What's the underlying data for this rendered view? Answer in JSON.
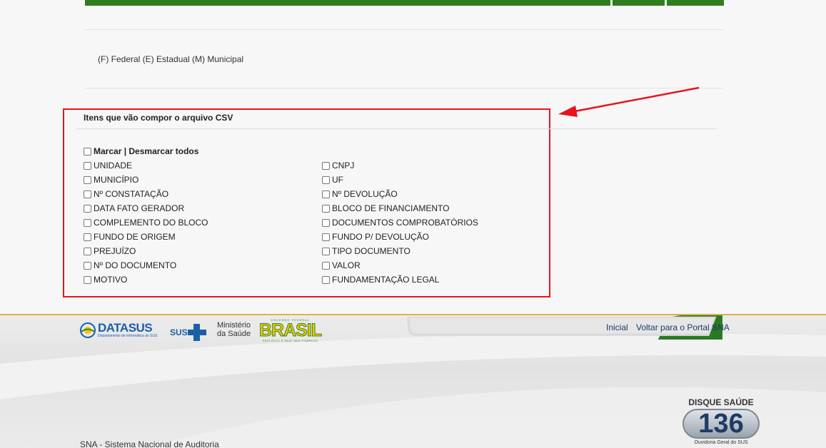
{
  "legend_text": "(F) Federal (E) Estadual (M) Municipal",
  "csv_section": {
    "title": "Itens que vão compor o arquivo CSV",
    "select_all_label": "Marcar | Desmarcar todos",
    "left_items": [
      "UNIDADE",
      "MUNICÍPIO",
      "Nº CONSTATAÇÃO",
      "DATA FATO GERADOR",
      "COMPLEMENTO DO BLOCO",
      "FUNDO DE ORIGEM",
      "PREJUÍZO",
      "Nº DO DOCUMENTO",
      "MOTIVO"
    ],
    "right_items": [
      "CNPJ",
      "UF",
      "Nº DEVOLUÇÃO",
      "BLOCO DE FINANCIAMENTO",
      "DOCUMENTOS COMPROBATÓRIOS",
      "FUNDO P/ DEVOLUÇÃO",
      "TIPO DOCUMENTO",
      "VALOR",
      "FUNDAMENTAÇÃO LEGAL"
    ]
  },
  "footer": {
    "datasus": "DATASUS",
    "datasus_sub": "Departamento de Informática do SUS",
    "sus": "SUS",
    "ministerio_line1": "Ministério",
    "ministerio_line2": "da Saúde",
    "brasil_top": "GOVERNO FEDERAL",
    "brasil": "BRASIL",
    "brasil_sub": "PAÍS RICO É PAÍS SEM POBREZA",
    "nav_inicial": "Inicial",
    "nav_voltar": "Voltar para o Portal SNA",
    "disque_title": "DISQUE SAÚDE",
    "disque_number": "136",
    "disque_sub": "Ouvidoria Geral do SUS",
    "system_name": "SNA - Sistema Nacional de Auditoria"
  },
  "colors": {
    "green_bar": "#2f7d1f",
    "highlight_red": "#e8141b",
    "link_blue": "#1a3a6b",
    "gold_line": "#e0b24a"
  },
  "icons": [
    "red-arrow-icon",
    "datasus-logo-icon",
    "sus-cross-icon"
  ]
}
